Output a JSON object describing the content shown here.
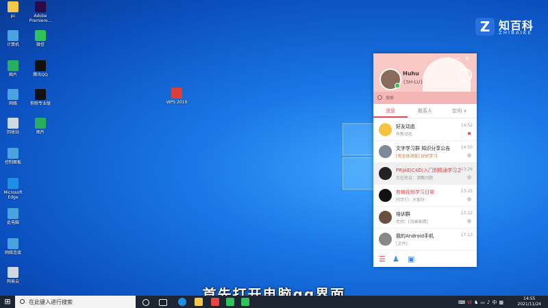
{
  "desktop": {
    "icons_left": [
      {
        "label": "pc",
        "color": "#f2c94c"
      },
      {
        "label": "Adobe Premiere...",
        "color": "#2a0a4a"
      },
      {
        "label": "计算机",
        "color": "#4aa3df"
      },
      {
        "label": "微信",
        "color": "#2ec45a"
      },
      {
        "label": "图片",
        "color": "#27ae60"
      },
      {
        "label": "腾讯QQ",
        "color": "#111111"
      },
      {
        "label": "网络",
        "color": "#4aa3df"
      },
      {
        "label": "剪映专业版",
        "color": "#111111"
      },
      {
        "label": "回收站",
        "color": "#cfd8e3"
      },
      {
        "label": "图片",
        "color": "#27ae60"
      },
      {
        "label": "控制面板",
        "color": "#4aa3df"
      },
      {
        "label": "Microsoft Edge",
        "color": "#1f8fe5"
      },
      {
        "label": "此电脑",
        "color": "#4aa3df"
      },
      {
        "label": "网络连接",
        "color": "#4aa3df"
      },
      {
        "label": "网易云",
        "color": "#cfd8e3"
      }
    ],
    "wps_icon_label": "WPS 2019"
  },
  "brand": {
    "mark": "Z",
    "cn": "知百科",
    "en": "ZHIBAIKE"
  },
  "qq": {
    "nickname": "Huhu",
    "signature": "{SH-LU}",
    "search_placeholder": "搜索",
    "tabs": [
      "消息",
      "联系人",
      "空间 ∨"
    ],
    "messages": [
      {
        "name": "好友动态",
        "sub": "有新动态",
        "time": "14:52",
        "name_red": false,
        "sub_red": false,
        "badge": "red",
        "avatar_color": "#f5c242"
      },
      {
        "name": "文字学习群 知识分享公告",
        "sub": "[有全体消息] 好好学习",
        "time": "14:50",
        "name_red": false,
        "sub_red": true,
        "badge": "grey",
        "avatar_color": "#7d8a99"
      },
      {
        "name": "PR|AE|C4D|入门到精通学习之群",
        "sub": "正在热议：请教问题",
        "time": "13:26",
        "name_red": true,
        "sub_red": false,
        "badge": "grey",
        "avatar_color": "#222222"
      },
      {
        "name": "剪辑视频学习日常",
        "sub": "同学们：大家好",
        "time": "13:25",
        "name_red": true,
        "sub_red": false,
        "badge": "grey",
        "avatar_color": "#111111"
      },
      {
        "name": "培训群",
        "sub": "老师：[动画表情]",
        "time": "13:12",
        "name_red": false,
        "sub_red": false,
        "badge": "grey",
        "avatar_color": "#6b4f3f"
      },
      {
        "name": "我的Android手机",
        "sub": "[文件]",
        "time": "17:13",
        "name_red": false,
        "sub_red": false,
        "badge": "none",
        "avatar_color": "#888888"
      }
    ]
  },
  "subtitle": "首先打开电脑qq界面",
  "taskbar": {
    "search_placeholder": "在此键入进行搜索",
    "tray_text": "中",
    "time": "14:55",
    "date": "2021/11/24"
  }
}
